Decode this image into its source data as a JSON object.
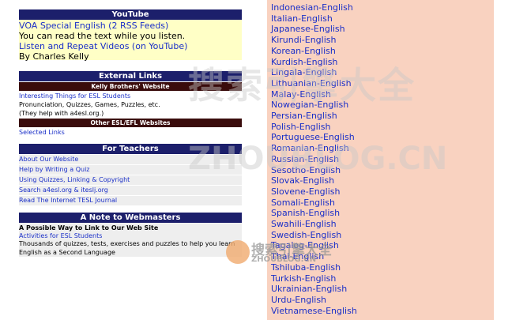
{
  "youtube": {
    "header": "YouTube",
    "link1": "VOA Special English (2 RSS Feeds)",
    "text1": "You can read the text while you listen.",
    "link2": "Listen and Repeat Videos (on YouTube)",
    "text2": "By Charles Kelly"
  },
  "external": {
    "header": "External Links",
    "sub1": "Kelly Brothers' Website",
    "link1": "Interesting Things for ESL Students",
    "text1": "Pronunciation, Quizzes, Games, Puzzles, etc.",
    "text2": "(They help with a4esl.org.)",
    "sub2": "Other ESL/EFL Websites",
    "link2": "Selected Links"
  },
  "teachers": {
    "header": "For Teachers",
    "items": [
      "About Our Website",
      "Help by Writing a Quiz",
      "Using Quizzes, Linking & Copyright",
      "Search a4esl.org & iteslj.org",
      "Read The Internet TESL Journal"
    ]
  },
  "webmasters": {
    "header": "A Note to Webmasters",
    "bold": "A Possible Way to Link to Our Web Site",
    "link": "Activities for ESL Students",
    "text": "Thousands of quizzes, tests, exercises and puzzles to help you learn English as a Second Language"
  },
  "languages": [
    "Indonesian-English",
    "Italian-English",
    "Japanese-English",
    "Kirundi-English",
    "Korean-English",
    "Kurdish-English",
    "Lingala-English",
    "Lithuanian-English",
    "Malay-English",
    "Nowegian-English",
    "Persian-English",
    "Polish-English",
    "Portuguese-English",
    "Romanian-English",
    "Russian-English",
    "Sesotho-English",
    "Slovak-English",
    "Slovene-English",
    "Somali-English",
    "Spanish-English",
    "Swahili-English",
    "Swedish-English",
    "Tagalog-English",
    "Thai-English",
    "Tshiluba-English",
    "Turkish-English",
    "Ukrainian-English",
    "Urdu-English",
    "Vietnamese-English"
  ],
  "watermark": {
    "big": "搜索引擎大全",
    "url": "ZHOUBLOG.CN",
    "small": "搜索引擎大全",
    "small_url": "ZHOUBLOG.CN"
  }
}
